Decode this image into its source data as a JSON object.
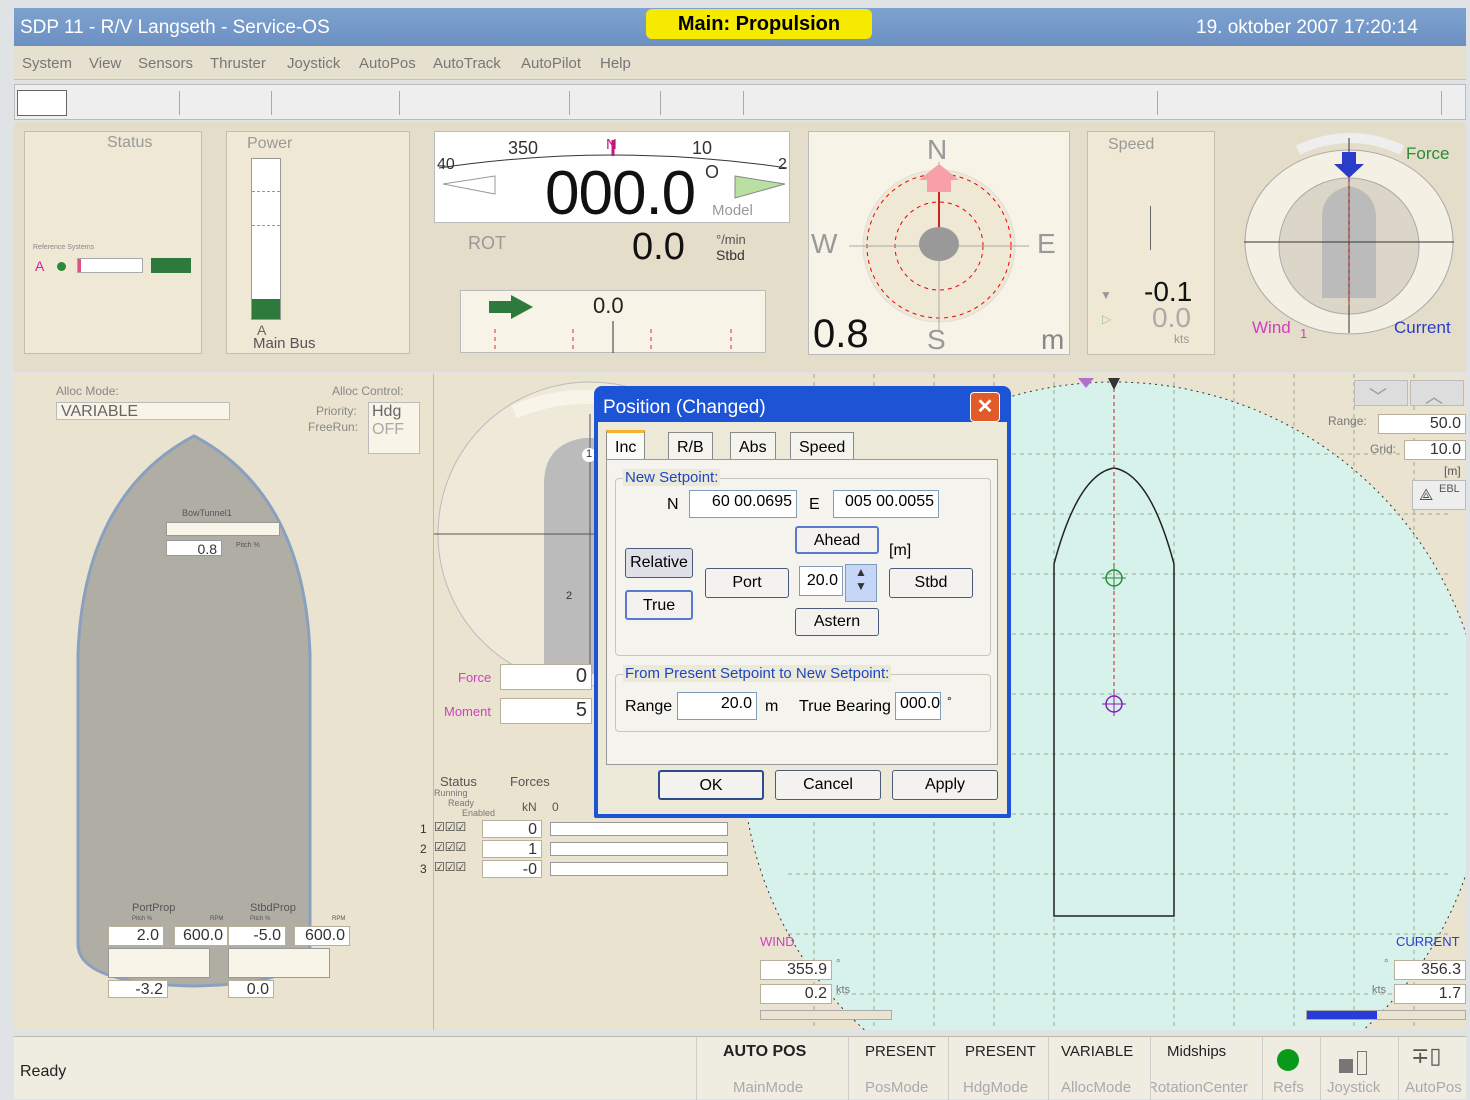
{
  "titlebar": {
    "left": "SDP 11 -   R/V Langseth   - Service-OS",
    "mode": "Main: Propulsion",
    "datetime": "19. oktober 2007 17:20:14"
  },
  "menu": [
    "System",
    "View",
    "Sensors",
    "Thruster",
    "Joystick",
    "AutoPos",
    "AutoTrack",
    "AutoPilot",
    "Help"
  ],
  "status_panel": {
    "title": "Status",
    "ref_label": "Reference Systems",
    "ref_id": "A"
  },
  "power_panel": {
    "title": "Power",
    "bus_id": "A",
    "bus_label": "Main Bus"
  },
  "heading_panel": {
    "tick_350": "350",
    "tick_n": "N",
    "tick_10": "10",
    "tick_left": "40",
    "tick_right": "2",
    "heading": "000.0",
    "deg": "O",
    "model": "Model",
    "rot_label": "ROT",
    "rot_value": "0.0",
    "rot_unit": "°/min",
    "rot_dir": "Stbd",
    "offset_value": "0.0"
  },
  "position_panel": {
    "n": "N",
    "s": "S",
    "w": "W",
    "e": "E",
    "value": "0.8",
    "unit": "m"
  },
  "speed_panel": {
    "title": "Speed",
    "v1": "-0.1",
    "v2": "0.0",
    "unit": "kts"
  },
  "force_panel": {
    "force": "Force",
    "wind": "Wind",
    "wind_num": "1",
    "current": "Current"
  },
  "alloc": {
    "mode_label": "Alloc Mode:",
    "mode_value": "VARIABLE",
    "control_label": "Alloc Control:",
    "priority_label": "Priority:",
    "priority_value": "Hdg",
    "freerun_label": "FreeRun:",
    "freerun_value": "OFF",
    "bow_label": "BowTunnel1",
    "bow_value": "0.8",
    "bow_unit": "Pitch %",
    "portprop": "PortProp",
    "stbdprop": "StbdProp",
    "pitch": "Pitch %",
    "rpm": "RPM",
    "port_pitch": "2.0",
    "port_rpm": "600.0",
    "stbd_pitch": "-5.0",
    "stbd_rpm": "600.0",
    "port_angle": "-3.2",
    "stbd_angle": "0.0"
  },
  "thrust": {
    "force_label": "Force",
    "force_value": "0",
    "moment_label": "Moment",
    "moment_value": "5",
    "mark1": "1",
    "mark2": "2",
    "status": "Status",
    "running": "Running",
    "ready": "Ready",
    "enabled": "Enabled",
    "forces": "Forces",
    "kn": "kN",
    "zero": "0",
    "rows": [
      {
        "n": "1",
        "v": "0"
      },
      {
        "n": "2",
        "v": "1"
      },
      {
        "n": "3",
        "v": "-0"
      }
    ]
  },
  "radar": {
    "range_label": "Range:",
    "range_value": "50.0",
    "grid_label": "Grid:",
    "grid_value": "10.0",
    "unit": "[m]",
    "ebl": "EBL",
    "wind_label": "WIND",
    "wind_dir": "355.9",
    "wind_speed": "0.2",
    "current_label": "CURRENT",
    "current_dir": "356.3",
    "current_speed": "1.7",
    "deg": "°",
    "kts": "kts"
  },
  "dialog": {
    "title": "Position (Changed)",
    "tabs": [
      "Inc",
      "R/B",
      "Abs",
      "Speed"
    ],
    "new_setpoint": "New Setpoint:",
    "n_label": "N",
    "n_value": "60 00.0695",
    "e_label": "E",
    "e_value": "005 00.0055",
    "relative": "Relative",
    "true": "True",
    "ahead": "Ahead",
    "m_unit": "[m]",
    "port": "Port",
    "step": "20.0",
    "stbd": "Stbd",
    "astern": "Astern",
    "from_label": "From Present Setpoint to New Setpoint:",
    "range_label": "Range",
    "range_value": "20.0",
    "m": "m",
    "bearing_label": "True Bearing",
    "bearing_value": "000.0",
    "deg": "°",
    "ok": "OK",
    "cancel": "Cancel",
    "apply": "Apply"
  },
  "statusbar": {
    "ready": "Ready",
    "cells": [
      {
        "val": "AUTO POS",
        "sub": "MainMode"
      },
      {
        "val": "PRESENT",
        "sub": "PosMode"
      },
      {
        "val": "PRESENT",
        "sub": "HdgMode"
      },
      {
        "val": "VARIABLE",
        "sub": "AllocMode"
      },
      {
        "val": "Midships",
        "sub": "RotationCenter"
      }
    ],
    "refs": "Refs",
    "joystick": "Joystick",
    "autopos": "AutoPos"
  }
}
